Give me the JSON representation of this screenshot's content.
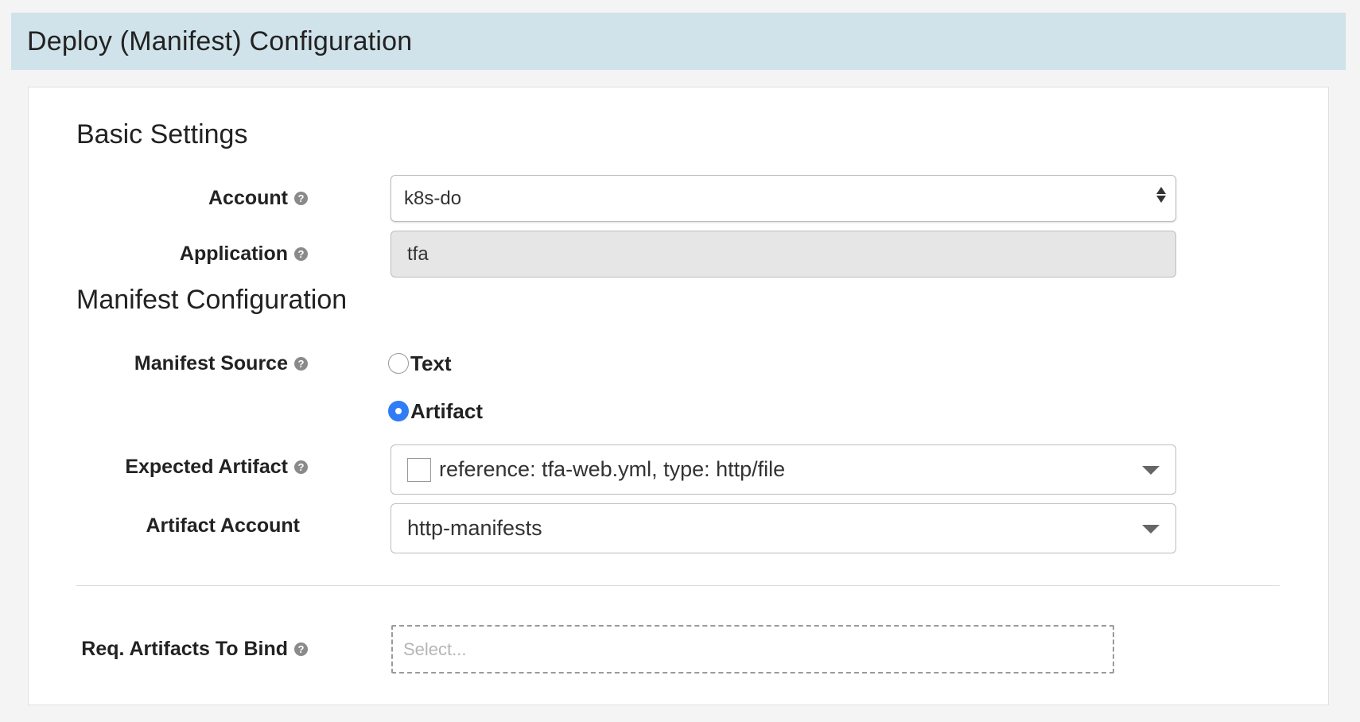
{
  "header": {
    "title": "Deploy (Manifest) Configuration"
  },
  "basic_settings": {
    "heading": "Basic Settings",
    "account": {
      "label": "Account",
      "value": "k8s-do"
    },
    "application": {
      "label": "Application",
      "value": "tfa"
    }
  },
  "manifest_configuration": {
    "heading": "Manifest Configuration",
    "manifest_source": {
      "label": "Manifest Source",
      "options": [
        {
          "label": "Text",
          "selected": false
        },
        {
          "label": "Artifact",
          "selected": true
        }
      ]
    },
    "expected_artifact": {
      "label": "Expected Artifact",
      "value": "reference: tfa-web.yml, type: http/file"
    },
    "artifact_account": {
      "label": "Artifact Account",
      "value": "http-manifests"
    }
  },
  "required_artifacts": {
    "label": "Req. Artifacts To Bind",
    "placeholder": "Select..."
  },
  "icons": {
    "help": "question-circle-icon",
    "select_arrows": "up-down-arrows-icon",
    "dropdown_caret": "caret-down-icon"
  },
  "colors": {
    "header_bg": "#d0e2ea",
    "radio_selected": "#2f7cf6",
    "disabled_bg": "#e6e6e6"
  }
}
